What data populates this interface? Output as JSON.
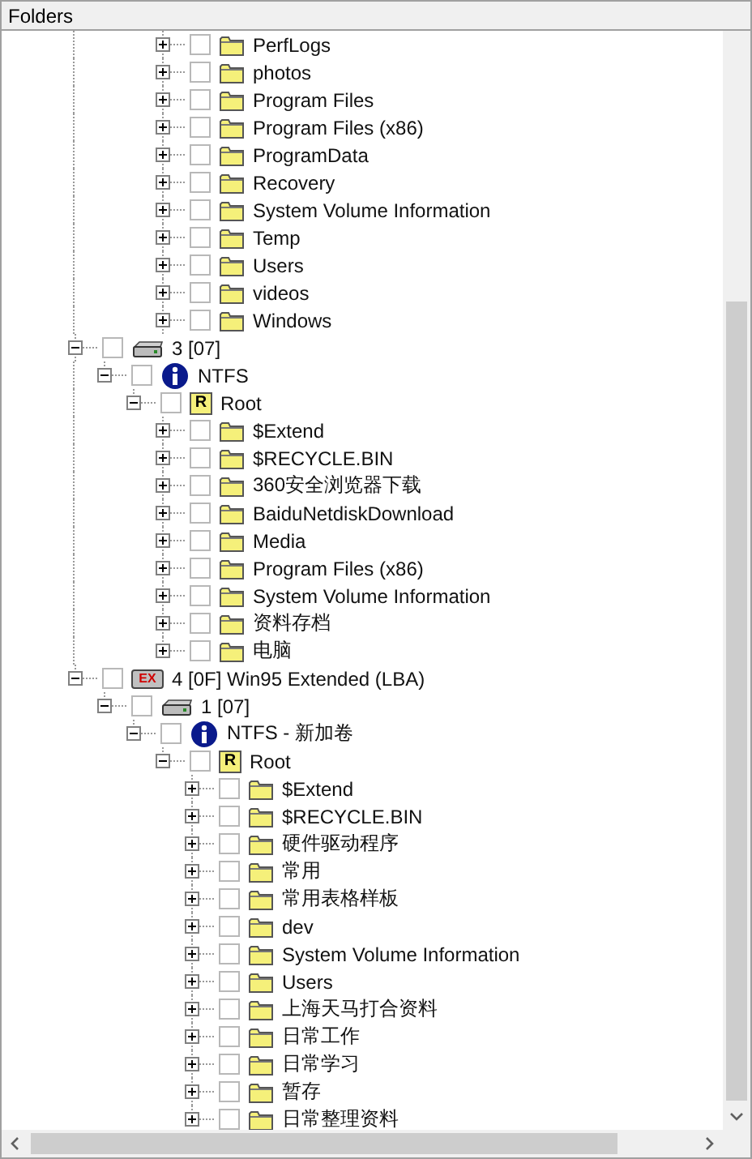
{
  "header": {
    "title": "Folders"
  },
  "scrolled_folders": [
    {
      "kind": "folder",
      "label": "PerfLogs",
      "expanded": false,
      "checked": false
    },
    {
      "kind": "folder",
      "label": "photos",
      "expanded": false,
      "checked": false
    },
    {
      "kind": "folder",
      "label": "Program Files",
      "expanded": false,
      "checked": false
    },
    {
      "kind": "folder",
      "label": "Program Files (x86)",
      "expanded": false,
      "checked": false
    },
    {
      "kind": "folder",
      "label": "ProgramData",
      "expanded": false,
      "checked": false
    },
    {
      "kind": "folder",
      "label": "Recovery",
      "expanded": false,
      "checked": false
    },
    {
      "kind": "folder",
      "label": "System Volume Information",
      "expanded": false,
      "checked": false
    },
    {
      "kind": "folder",
      "label": "Temp",
      "expanded": false,
      "checked": false
    },
    {
      "kind": "folder",
      "label": "Users",
      "expanded": false,
      "checked": false
    },
    {
      "kind": "folder",
      "label": "videos",
      "expanded": false,
      "checked": false
    },
    {
      "kind": "folder",
      "label": "Windows",
      "expanded": false,
      "checked": false
    }
  ],
  "partitions": [
    {
      "kind": "drive",
      "label": "3 [07]",
      "expanded": true,
      "checked": false,
      "children": [
        {
          "kind": "volume",
          "label": "NTFS",
          "expanded": true,
          "checked": false,
          "children": [
            {
              "kind": "root",
              "badge": "R",
              "label": "Root",
              "expanded": true,
              "checked": false,
              "children": [
                {
                  "kind": "folder",
                  "label": "$Extend",
                  "expanded": false,
                  "checked": false
                },
                {
                  "kind": "folder",
                  "label": "$RECYCLE.BIN",
                  "expanded": false,
                  "checked": false
                },
                {
                  "kind": "folder",
                  "label": "360安全浏览器下载",
                  "expanded": false,
                  "checked": false
                },
                {
                  "kind": "folder",
                  "label": "BaiduNetdiskDownload",
                  "expanded": false,
                  "checked": false
                },
                {
                  "kind": "folder",
                  "label": "Media",
                  "expanded": false,
                  "checked": false
                },
                {
                  "kind": "folder",
                  "label": "Program Files (x86)",
                  "expanded": false,
                  "checked": false
                },
                {
                  "kind": "folder",
                  "label": "System Volume Information",
                  "expanded": false,
                  "checked": false
                },
                {
                  "kind": "folder",
                  "label": "资料存档",
                  "expanded": false,
                  "checked": false
                },
                {
                  "kind": "folder",
                  "label": "电脑",
                  "expanded": false,
                  "checked": false
                }
              ]
            }
          ]
        }
      ]
    },
    {
      "kind": "extended",
      "badge": "EX",
      "label": "4 [0F] Win95 Extended  (LBA)",
      "expanded": true,
      "checked": false,
      "children": [
        {
          "kind": "drive",
          "label": "1 [07]",
          "expanded": true,
          "checked": false,
          "children": [
            {
              "kind": "volume",
              "label": "NTFS - 新加卷",
              "expanded": true,
              "checked": false,
              "children": [
                {
                  "kind": "root",
                  "badge": "R",
                  "label": "Root",
                  "expanded": true,
                  "checked": false,
                  "children": [
                    {
                      "kind": "folder",
                      "label": "$Extend",
                      "expanded": false,
                      "checked": false
                    },
                    {
                      "kind": "folder",
                      "label": "$RECYCLE.BIN",
                      "expanded": false,
                      "checked": false
                    },
                    {
                      "kind": "folder",
                      "label": "硬件驱动程序",
                      "expanded": false,
                      "checked": false
                    },
                    {
                      "kind": "folder",
                      "label": "常用",
                      "expanded": false,
                      "checked": false
                    },
                    {
                      "kind": "folder",
                      "label": "常用表格样板",
                      "expanded": false,
                      "checked": false
                    },
                    {
                      "kind": "folder",
                      "label": "dev",
                      "expanded": false,
                      "checked": false
                    },
                    {
                      "kind": "folder",
                      "label": "System Volume Information",
                      "expanded": false,
                      "checked": false
                    },
                    {
                      "kind": "folder",
                      "label": "Users",
                      "expanded": false,
                      "checked": false
                    },
                    {
                      "kind": "folder",
                      "label": "上海天马打合资料",
                      "expanded": false,
                      "checked": false
                    },
                    {
                      "kind": "folder",
                      "label": "日常工作",
                      "expanded": false,
                      "checked": false
                    },
                    {
                      "kind": "folder",
                      "label": "日常学习",
                      "expanded": false,
                      "checked": false
                    },
                    {
                      "kind": "folder",
                      "label": "暂存",
                      "expanded": false,
                      "checked": false
                    },
                    {
                      "kind": "folder",
                      "label": "日常整理资料",
                      "expanded": false,
                      "checked": false
                    }
                  ]
                }
              ]
            }
          ]
        }
      ]
    }
  ]
}
